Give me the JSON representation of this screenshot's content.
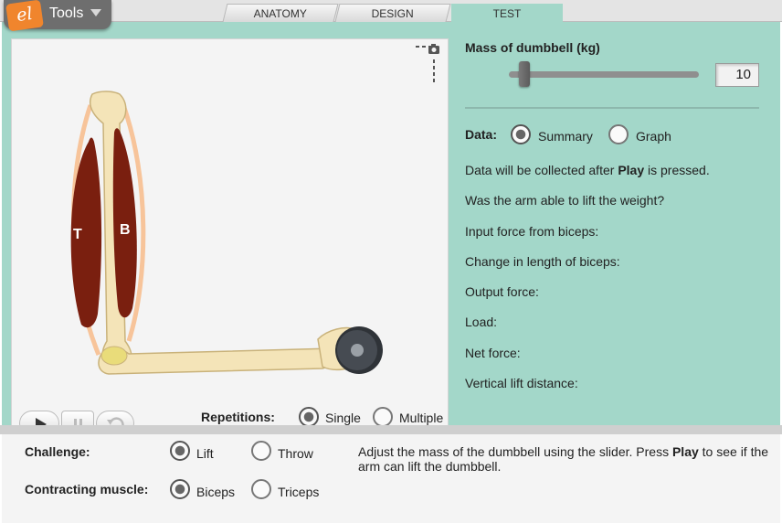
{
  "tools": {
    "logo_text": "el",
    "label": "Tools"
  },
  "tabs": [
    {
      "label": "ANATOMY",
      "active": false
    },
    {
      "label": "DESIGN",
      "active": false
    },
    {
      "label": "TEST",
      "active": true
    }
  ],
  "simulation": {
    "muscle_labels": {
      "triceps": "T",
      "biceps": "B"
    },
    "repetitions": {
      "label": "Repetitions:",
      "options": [
        {
          "label": "Single",
          "selected": true
        },
        {
          "label": "Multiple",
          "selected": false
        }
      ]
    }
  },
  "mass": {
    "label": "Mass of dumbbell (kg)",
    "value": "10",
    "slider_fraction": 0.08
  },
  "data_view": {
    "label": "Data:",
    "options": [
      {
        "label": "Summary",
        "selected": true
      },
      {
        "label": "Graph",
        "selected": false
      }
    ]
  },
  "summary": {
    "note_prefix": "Data will be collected after ",
    "note_bold": "Play",
    "note_suffix": " is pressed.",
    "rows": [
      "Was the arm able to lift the weight?",
      "Input force from biceps:",
      "Change in length of biceps:",
      "Output force:",
      "Load:",
      "Net force:",
      "Vertical lift distance:"
    ]
  },
  "controls": {
    "challenge": {
      "label": "Challenge:",
      "options": [
        {
          "label": "Lift",
          "selected": true
        },
        {
          "label": "Throw",
          "selected": false
        }
      ]
    },
    "contracting_muscle": {
      "label": "Contracting muscle:",
      "options": [
        {
          "label": "Biceps",
          "selected": true
        },
        {
          "label": "Triceps",
          "selected": false
        }
      ]
    },
    "instructions": {
      "part1": "Adjust the mass of the dumbbell using the slider. Press ",
      "bold": "Play",
      "part2": " to see if the arm can lift the dumbbell."
    }
  },
  "colors": {
    "panel": "#a3d7c9",
    "muscle": "#7a1f0f",
    "bone": "#f4e4b8",
    "tendon": "#f7c49a"
  }
}
